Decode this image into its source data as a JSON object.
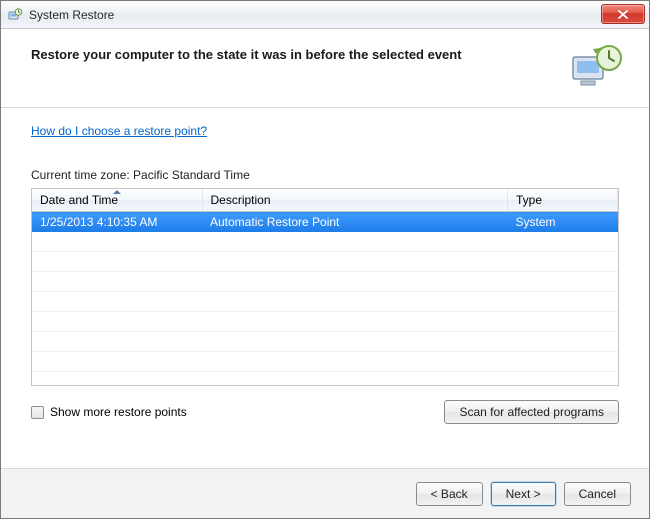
{
  "window": {
    "title": "System Restore"
  },
  "header": {
    "title": "Restore your computer to the state it was in before the selected event"
  },
  "help_link": "How do I choose a restore point?",
  "timezone_label": "Current time zone: Pacific Standard Time",
  "table": {
    "columns": {
      "datetime": "Date and Time",
      "description": "Description",
      "type": "Type"
    },
    "rows": [
      {
        "datetime": "1/25/2013 4:10:35 AM",
        "description": "Automatic Restore Point",
        "type": "System",
        "selected": true
      }
    ]
  },
  "show_more": {
    "label": "Show more restore points",
    "checked": false
  },
  "buttons": {
    "scan": "Scan for affected programs",
    "back": "< Back",
    "next": "Next >",
    "cancel": "Cancel"
  }
}
